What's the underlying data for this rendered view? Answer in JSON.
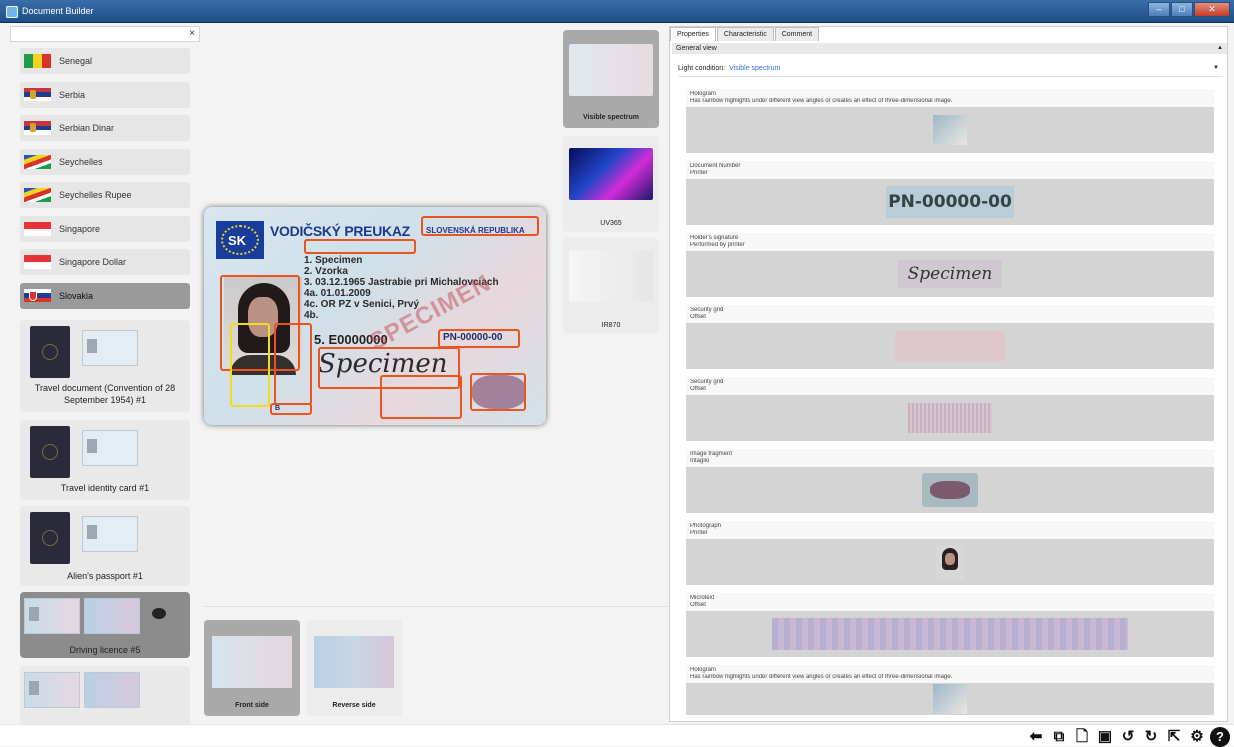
{
  "window": {
    "title": "Document Builder"
  },
  "sidebar": {
    "search_clear": "×",
    "countries": [
      {
        "label": "Senegal",
        "flag": "senegal"
      },
      {
        "label": "Serbia",
        "flag": "serbia"
      },
      {
        "label": "Serbian Dinar",
        "flag": "serbia"
      },
      {
        "label": "Seychelles",
        "flag": "seychelles"
      },
      {
        "label": "Seychelles Rupee",
        "flag": "seychelles"
      },
      {
        "label": "Singapore",
        "flag": "singapore"
      },
      {
        "label": "Singapore Dollar",
        "flag": "singapore"
      },
      {
        "label": "Slovakia",
        "flag": "slovakia",
        "selected": true
      }
    ],
    "documents": [
      {
        "label": "Travel document (Convention of 28 September 1954) #1"
      },
      {
        "label": "Travel identity card #1"
      },
      {
        "label": "Alien's passport #1"
      },
      {
        "label": "Driving licence #5",
        "selected": true
      },
      {
        "label": ""
      }
    ]
  },
  "card": {
    "country_code": "SK",
    "title": "VODIČSKÝ PREUKAZ",
    "title_country": "SLOVENSKÁ REPUBLIKA",
    "lines": [
      "1. Specimen",
      "2. Vzorka",
      "3. 03.12.1965 Jastrabie pri Michalovciach",
      "4a. 01.01.2009",
      "4c. OR PZ v Senici, Prvý",
      "4b."
    ],
    "doc_number": "PN-00000-00",
    "licence_number": "5. E0000000",
    "signature": "Specimen",
    "watermark": "SPECIMEN",
    "category": "B"
  },
  "spectra": [
    {
      "label": "Visible spectrum",
      "selected": true
    },
    {
      "label": "UV365"
    },
    {
      "label": "IR870"
    }
  ],
  "sides": [
    {
      "label": "Front side",
      "selected": true
    },
    {
      "label": "Reverse side"
    }
  ],
  "panel": {
    "tabs": [
      {
        "label": "Properties",
        "selected": true
      },
      {
        "label": "Characteristic"
      },
      {
        "label": "Comment"
      }
    ],
    "section": "General view",
    "light_label": "Light condition:",
    "light_value": "Visible spectrum",
    "features": [
      {
        "name": "Hologram",
        "detail": "Has rainbow highlights under different view angles or creates an effect of three-dimensional image.",
        "kind": "holo"
      },
      {
        "name": "Document Number",
        "detail": "Printer",
        "kind": "docnum",
        "value": "PN-00000-00"
      },
      {
        "name": "Holder's signature",
        "detail": "Performed by printer",
        "kind": "sig",
        "value": "Specimen"
      },
      {
        "name": "Security grid",
        "detail": "Offset",
        "kind": "grid1"
      },
      {
        "name": "Security grid",
        "detail": "Offset",
        "kind": "grid2"
      },
      {
        "name": "Image fragment",
        "detail": "Intaglio",
        "kind": "map"
      },
      {
        "name": "Photograph",
        "detail": "Printer",
        "kind": "photo"
      },
      {
        "name": "Microtext",
        "detail": "Offset",
        "kind": "micro"
      },
      {
        "name": "Hologram",
        "detail": "Has rainbow highlights under different view angles or creates an effect of three-dimensional image.",
        "kind": "holo"
      }
    ]
  },
  "toolbar": {
    "icons": [
      "arrow-left-icon",
      "document-frame-icon",
      "new-document-icon",
      "image-icon",
      "undo-icon",
      "redo-icon",
      "export-icon",
      "settings-icon",
      "help-icon"
    ]
  }
}
